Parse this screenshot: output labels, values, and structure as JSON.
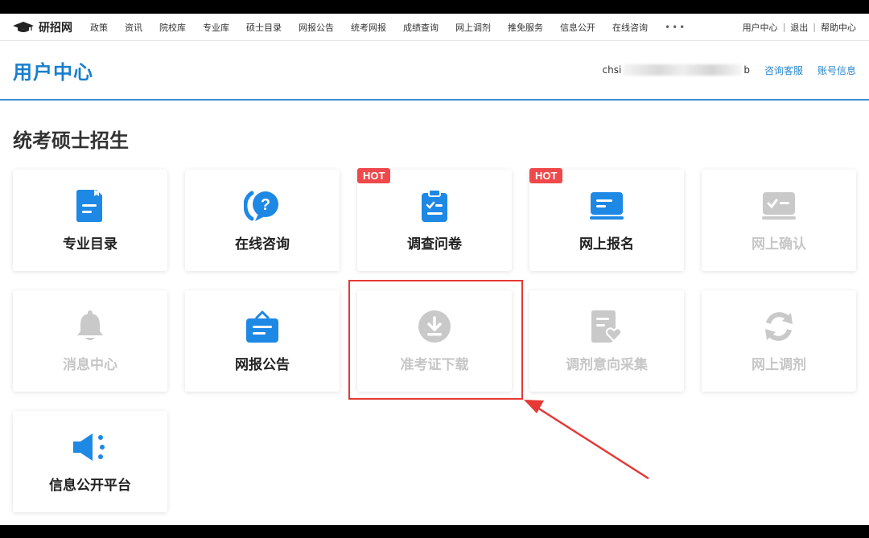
{
  "topnav": {
    "logo_text": "研招网",
    "items": [
      "政策",
      "资讯",
      "院校库",
      "专业库",
      "硕士目录",
      "网报公告",
      "统考网报",
      "成绩查询",
      "网上调剂",
      "推免服务",
      "信息公开",
      "在线咨询"
    ],
    "more": "•••",
    "right": {
      "user_center": "用户中心",
      "logout": "退出",
      "help": "帮助中心",
      "separator": "|"
    }
  },
  "header": {
    "title": "用户中心",
    "user_prefix": "chsi",
    "user_suffix": "b",
    "consult_link": "咨询客服",
    "account_link": "账号信息"
  },
  "section": {
    "title": "统考硕士招生"
  },
  "cards": [
    {
      "label": "专业目录",
      "icon": "document-icon",
      "enabled": true,
      "hot": false
    },
    {
      "label": "在线咨询",
      "icon": "chat-question-icon",
      "enabled": true,
      "hot": false
    },
    {
      "label": "调查问卷",
      "icon": "clipboard-check-icon",
      "enabled": true,
      "hot": true
    },
    {
      "label": "网上报名",
      "icon": "monitor-icon",
      "enabled": true,
      "hot": true
    },
    {
      "label": "网上确认",
      "icon": "monitor-check-icon",
      "enabled": false,
      "hot": false
    },
    {
      "label": "消息中心",
      "icon": "bell-icon",
      "enabled": false,
      "hot": false
    },
    {
      "label": "网报公告",
      "icon": "notice-board-icon",
      "enabled": true,
      "hot": false
    },
    {
      "label": "准考证下载",
      "icon": "download-icon",
      "enabled": false,
      "hot": false
    },
    {
      "label": "调剂意向采集",
      "icon": "form-heart-icon",
      "enabled": false,
      "hot": false
    },
    {
      "label": "网上调剂",
      "icon": "refresh-icon",
      "enabled": false,
      "hot": false
    },
    {
      "label": "信息公开平台",
      "icon": "speaker-icon",
      "enabled": true,
      "hot": false
    }
  ],
  "hot_label": "HOT",
  "colors": {
    "accent": "#1a7fcb",
    "icon_blue": "#1e88e5",
    "disabled": "#c6c6c6",
    "hot": "#f0494b",
    "annotation": "#e53935"
  }
}
